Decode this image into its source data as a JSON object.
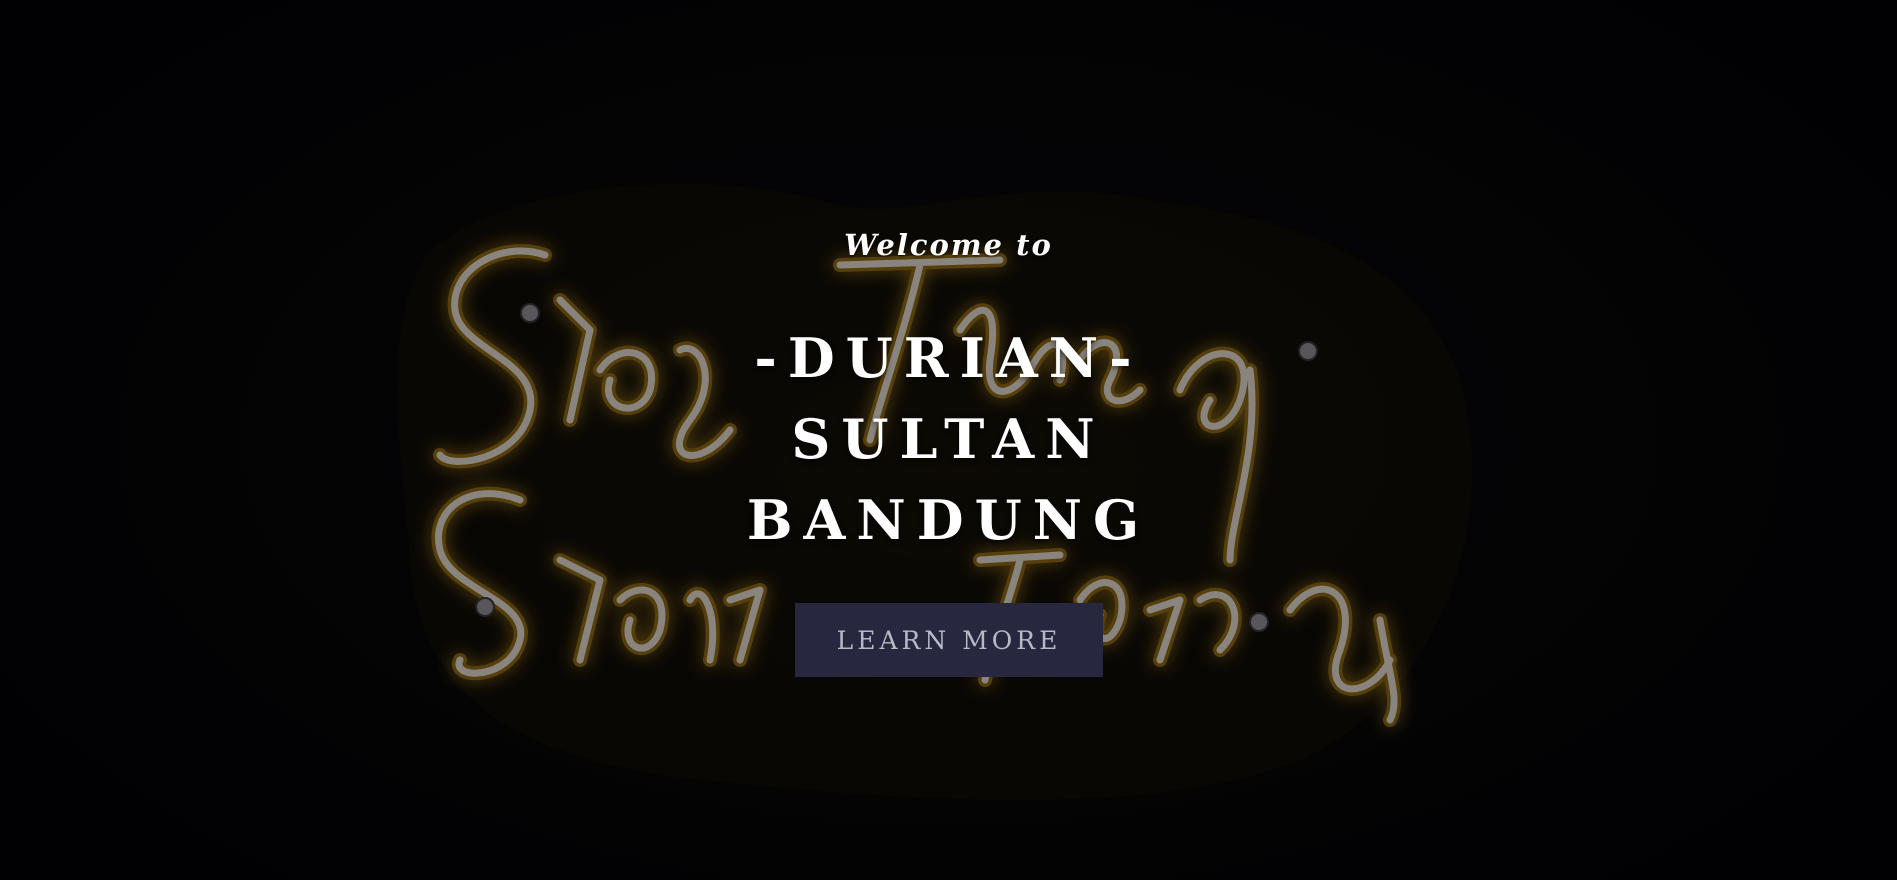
{
  "hero": {
    "welcome_text": "Welcome to",
    "title_lines": [
      "-DURIAN-",
      "SULTAN",
      "BANDUNG"
    ],
    "button_label": "LEARN MORE",
    "background_image": "neon-sign-image",
    "colors": {
      "background": "#030306",
      "neon_tube": "#b8b6bd",
      "neon_glow": "#d9a21a",
      "button_bg": "#27273f",
      "button_text": "#b9b9c6",
      "heading_text": "#ffffff"
    }
  }
}
